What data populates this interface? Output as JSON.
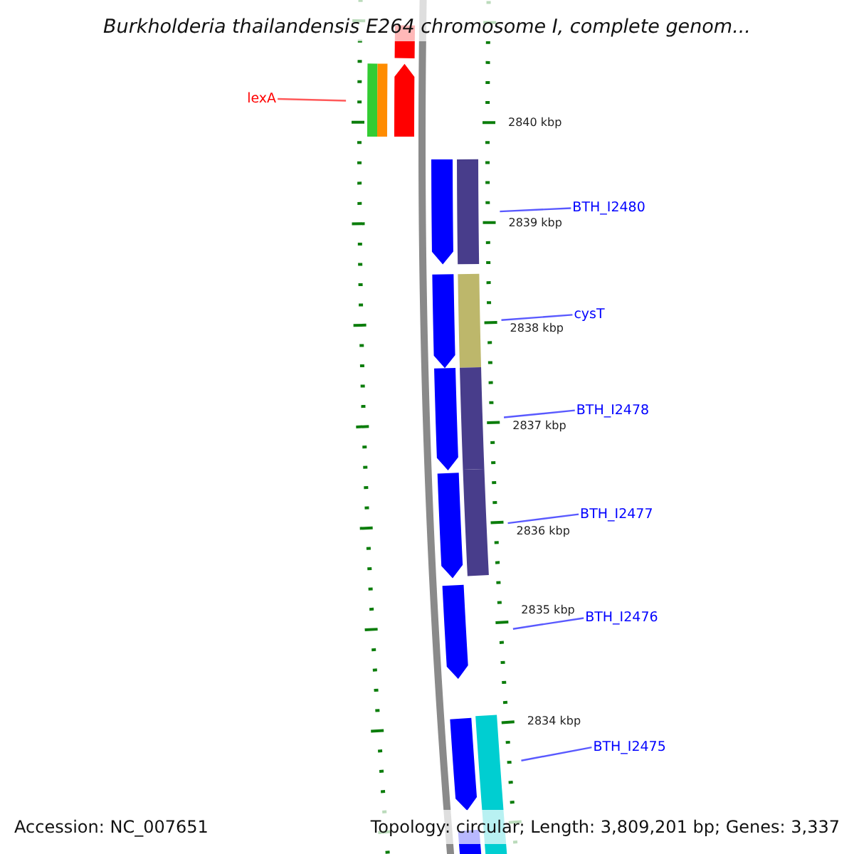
{
  "title": "Burkholderia thailandensis E264 chromosome I, complete genom...",
  "tracks": [
    {
      "features": [
        {
          "color": "#33cc33",
          "kind": "block"
        }
      ]
    },
    {
      "features": [
        {
          "color": "#ff8c00",
          "kind": "block"
        }
      ]
    },
    {
      "features": [
        {
          "color": "#ff0000",
          "kind": "block"
        },
        {
          "color": "#ff0000",
          "kind": "forward",
          "label": "lexA"
        }
      ]
    },
    {
      "features": [
        {
          "color": "#0000ff",
          "kind": "reverse",
          "label": "BTH_I2480"
        },
        {
          "color": "#0000ff",
          "kind": "reverse",
          "label": "cysT"
        },
        {
          "color": "#0000ff",
          "kind": "reverse",
          "label": "BTH_I2478"
        },
        {
          "color": "#0000ff",
          "kind": "reverse",
          "label": "BTH_I2477"
        },
        {
          "color": "#0000ff",
          "kind": "reverse",
          "label": "BTH_I2476"
        },
        {
          "color": "#0000ff",
          "kind": "reverse",
          "label": "BTH_I2475"
        },
        {
          "color": "#0000ff",
          "kind": "reverse"
        }
      ]
    },
    {
      "features": [
        {
          "color": "#483d8b",
          "kind": "block"
        },
        {
          "color": "#bdb76b",
          "kind": "block"
        },
        {
          "color": "#483d8b",
          "kind": "block"
        },
        {
          "color": "#483d8b",
          "kind": "block"
        },
        {
          "color": "#00ced1",
          "kind": "block"
        }
      ]
    }
  ],
  "scale_labels": [
    "2840 kbp",
    "2839 kbp",
    "2838 kbp",
    "2837 kbp",
    "2836 kbp",
    "2835 kbp",
    "2834 kbp"
  ],
  "footer": {
    "accession": "Accession: NC_007651",
    "summary": "Topology: circular; Length: 3,809,201 bp; Genes: 3,337"
  }
}
